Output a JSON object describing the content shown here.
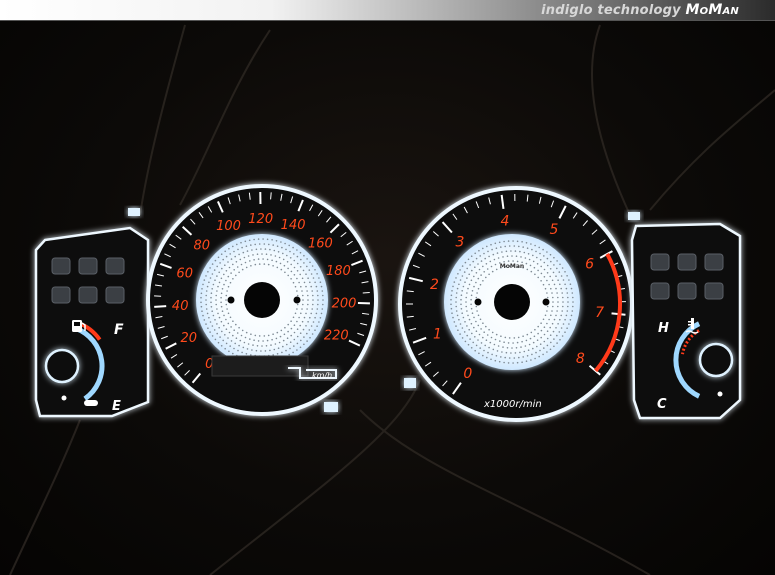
{
  "banner": {
    "prefix": "indiglo technology",
    "brand": "MoMan"
  },
  "speedometer": {
    "labels": [
      "0",
      "20",
      "40",
      "60",
      "80",
      "100",
      "120",
      "140",
      "160",
      "180",
      "200",
      "220"
    ],
    "unit": "km/h"
  },
  "tachometer": {
    "labels": [
      "0",
      "1",
      "2",
      "3",
      "4",
      "5",
      "6",
      "7",
      "8"
    ],
    "unit": "x1000r/min",
    "brand": "MoMan",
    "redline_from": 6
  },
  "fuel_gauge": {
    "full": "F",
    "empty": "E",
    "icon": "fuel-pump-icon"
  },
  "temp_gauge": {
    "hot": "H",
    "cold": "C",
    "icon": "coolant-temperature-icon"
  },
  "colors": {
    "glow": "#e8f6ff",
    "numerals": "#ff4a1c",
    "face": "#0a0a0a"
  }
}
